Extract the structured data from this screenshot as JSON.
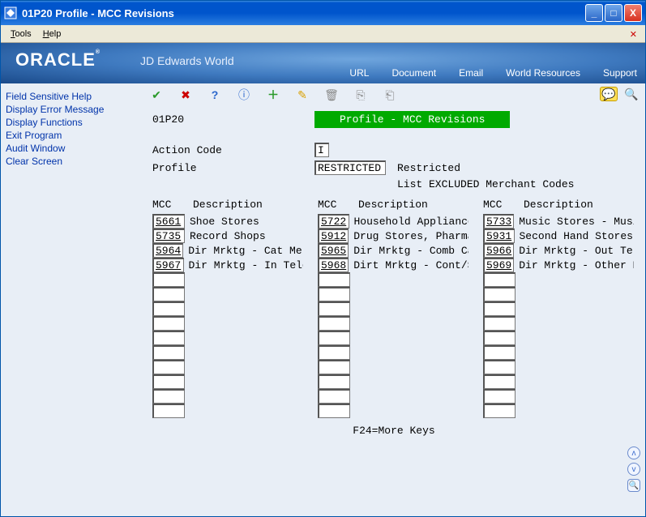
{
  "window": {
    "title": "01P20    Profile - MCC Revisions"
  },
  "menubar": {
    "tools": "Tools",
    "help": "Help"
  },
  "brand": {
    "logo": "ORACLE",
    "reg": "®",
    "sub": "JD Edwards World"
  },
  "headerlinks": {
    "url": "URL",
    "document": "Document",
    "email": "Email",
    "wr": "World Resources",
    "support": "Support"
  },
  "sidebar": {
    "items": [
      "Field Sensitive Help",
      "Display Error Message",
      "Display Functions",
      "Exit Program",
      "Audit Window",
      "Clear Screen"
    ]
  },
  "screen": {
    "code": "01P20",
    "title": "Profile - MCC Revisions",
    "actioncode_label": "Action Code",
    "actioncode_value": "I",
    "profile_label": "Profile",
    "profile_value": "RESTRICTED",
    "profile_desc": "Restricted",
    "sub_desc": "List EXCLUDED Merchant Codes"
  },
  "colhdr": {
    "mcc": "MCC",
    "desc": "Description"
  },
  "cols": [
    {
      "rows": [
        {
          "mcc": "5661",
          "desc": "Shoe Stores"
        },
        {
          "mcc": "5735",
          "desc": "Record Shops"
        },
        {
          "mcc": "5964",
          "desc": "Dir Mrktg - Cat Merc"
        },
        {
          "mcc": "5967",
          "desc": "Dir Mrktg - In Tele"
        },
        {
          "mcc": "",
          "desc": ""
        },
        {
          "mcc": "",
          "desc": ""
        },
        {
          "mcc": "",
          "desc": ""
        },
        {
          "mcc": "",
          "desc": ""
        },
        {
          "mcc": "",
          "desc": ""
        },
        {
          "mcc": "",
          "desc": ""
        },
        {
          "mcc": "",
          "desc": ""
        },
        {
          "mcc": "",
          "desc": ""
        },
        {
          "mcc": "",
          "desc": ""
        },
        {
          "mcc": "",
          "desc": ""
        }
      ]
    },
    {
      "rows": [
        {
          "mcc": "5722",
          "desc": "Household Appliance"
        },
        {
          "mcc": "5912",
          "desc": "Drug Stores, Pharmac"
        },
        {
          "mcc": "5965",
          "desc": "Dir Mrktg - Comb Cat"
        },
        {
          "mcc": "5968",
          "desc": "Dirt Mrktg - Cont/Su"
        },
        {
          "mcc": "",
          "desc": ""
        },
        {
          "mcc": "",
          "desc": ""
        },
        {
          "mcc": "",
          "desc": ""
        },
        {
          "mcc": "",
          "desc": ""
        },
        {
          "mcc": "",
          "desc": ""
        },
        {
          "mcc": "",
          "desc": ""
        },
        {
          "mcc": "",
          "desc": ""
        },
        {
          "mcc": "",
          "desc": ""
        },
        {
          "mcc": "",
          "desc": ""
        },
        {
          "mcc": "",
          "desc": ""
        }
      ]
    },
    {
      "rows": [
        {
          "mcc": "5733",
          "desc": "Music Stores - Music"
        },
        {
          "mcc": "5931",
          "desc": "Second Hand Stores,"
        },
        {
          "mcc": "5966",
          "desc": "Dir Mrktg - Out Tele"
        },
        {
          "mcc": "5969",
          "desc": "Dir Mrktg - Other Di"
        },
        {
          "mcc": "",
          "desc": ""
        },
        {
          "mcc": "",
          "desc": ""
        },
        {
          "mcc": "",
          "desc": ""
        },
        {
          "mcc": "",
          "desc": ""
        },
        {
          "mcc": "",
          "desc": ""
        },
        {
          "mcc": "",
          "desc": ""
        },
        {
          "mcc": "",
          "desc": ""
        },
        {
          "mcc": "",
          "desc": ""
        },
        {
          "mcc": "",
          "desc": ""
        },
        {
          "mcc": "",
          "desc": ""
        }
      ]
    }
  ],
  "footer": "F24=More Keys"
}
